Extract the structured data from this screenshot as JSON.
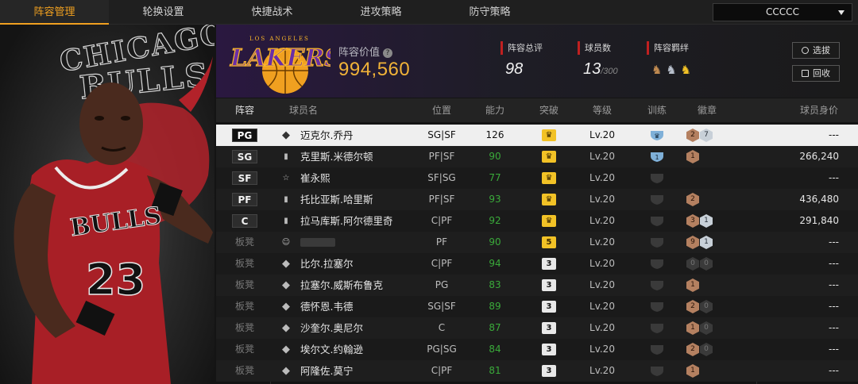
{
  "tabs": [
    "阵容管理",
    "轮换设置",
    "快捷战术",
    "进攻策略",
    "防守策略"
  ],
  "active_tab": 0,
  "team_select": {
    "value": "CCCCC"
  },
  "art": {
    "line1": "CHICAGO",
    "line2": "BULLS",
    "jersey_team": "BULLS",
    "jersey_number": "23"
  },
  "logo": {
    "small": "LOS ANGELES",
    "main": "LAKERS"
  },
  "header": {
    "value_label": "阵容价值",
    "help": "?",
    "value": "994,560",
    "overall_label": "阵容总评",
    "overall": "98",
    "players_label": "球员数",
    "players": "13",
    "players_max": "/300",
    "bond_label": "阵容羁绊",
    "btn_pick": "选拔",
    "btn_recycle": "回收"
  },
  "columns": [
    "阵容",
    "球员名",
    "位置",
    "能力",
    "突破",
    "等级",
    "训练",
    "徽章",
    "球员身价"
  ],
  "rows": [
    {
      "slot": "PG",
      "bench": false,
      "type": "COPY",
      "name": "迈克尔.乔丹",
      "pos": "SG|SF",
      "ability": "126",
      "breakthrough": "crown",
      "level": "Lv.20",
      "training": "blue",
      "badges": [
        [
          "b",
          "2"
        ],
        [
          "s",
          "7"
        ]
      ],
      "value": "---",
      "selected": true
    },
    {
      "slot": "SG",
      "bench": false,
      "type": "bars",
      "name": "克里斯.米德尔顿",
      "pos": "PF|SF",
      "ability": "90",
      "breakthrough": "crown",
      "level": "Lv.20",
      "training": "blue1",
      "badges": [
        [
          "b",
          "1"
        ]
      ],
      "value": "266,240"
    },
    {
      "slot": "SF",
      "bench": false,
      "type": "star",
      "name": "崔永熙",
      "pos": "SF|SG",
      "ability": "77",
      "breakthrough": "crown",
      "level": "Lv.20",
      "training": "none",
      "badges": [],
      "value": "---"
    },
    {
      "slot": "PF",
      "bench": false,
      "type": "bars",
      "name": "托比亚斯.哈里斯",
      "pos": "PF|SF",
      "ability": "93",
      "breakthrough": "crown",
      "level": "Lv.20",
      "training": "none",
      "badges": [
        [
          "b",
          "2"
        ]
      ],
      "value": "436,480"
    },
    {
      "slot": "C",
      "bench": false,
      "type": "bars",
      "name": "拉马库斯.阿尔德里奇",
      "pos": "C|PF",
      "ability": "92",
      "breakthrough": "crown",
      "level": "Lv.20",
      "training": "none",
      "badges": [
        [
          "b",
          "3"
        ],
        [
          "s",
          "1"
        ]
      ],
      "value": "291,840"
    },
    {
      "slot": "板凳",
      "bench": true,
      "type": "person",
      "name": "",
      "pos": "PF",
      "ability": "90",
      "breakthrough": "5",
      "level": "Lv.20",
      "training": "none",
      "badges": [
        [
          "b",
          "9"
        ],
        [
          "s",
          "1"
        ]
      ],
      "value": "---"
    },
    {
      "slot": "板凳",
      "bench": true,
      "type": "COPY",
      "name": "比尔.拉塞尔",
      "pos": "C|PF",
      "ability": "94",
      "breakthrough": "3",
      "level": "Lv.20",
      "training": "none",
      "badges": [
        [
          "d",
          "0"
        ],
        [
          "d",
          "0"
        ]
      ],
      "value": "---"
    },
    {
      "slot": "板凳",
      "bench": true,
      "type": "COPY",
      "name": "拉塞尔.威斯布鲁克",
      "pos": "PG",
      "ability": "83",
      "breakthrough": "3",
      "level": "Lv.20",
      "training": "none",
      "badges": [
        [
          "b",
          "1"
        ]
      ],
      "value": "---"
    },
    {
      "slot": "板凳",
      "bench": true,
      "type": "COPY",
      "name": "德怀恩.韦德",
      "pos": "SG|SF",
      "ability": "89",
      "breakthrough": "3",
      "level": "Lv.20",
      "training": "none",
      "badges": [
        [
          "b",
          "2"
        ],
        [
          "d",
          "0"
        ]
      ],
      "value": "---"
    },
    {
      "slot": "板凳",
      "bench": true,
      "type": "COPY",
      "name": "沙奎尔.奥尼尔",
      "pos": "C",
      "ability": "87",
      "breakthrough": "3",
      "level": "Lv.20",
      "training": "none",
      "badges": [
        [
          "b",
          "1"
        ],
        [
          "d",
          "0"
        ]
      ],
      "value": "---"
    },
    {
      "slot": "板凳",
      "bench": true,
      "type": "COPY",
      "name": "埃尔文.约翰逊",
      "pos": "PG|SG",
      "ability": "84",
      "breakthrough": "3",
      "level": "Lv.20",
      "training": "none",
      "badges": [
        [
          "b",
          "2"
        ],
        [
          "d",
          "0"
        ]
      ],
      "value": "---"
    },
    {
      "slot": "板凳",
      "bench": true,
      "type": "COPY",
      "name": "阿隆佐.莫宁",
      "pos": "C|PF",
      "ability": "81",
      "breakthrough": "3",
      "level": "Lv.20",
      "training": "none",
      "badges": [
        [
          "b",
          "1"
        ]
      ],
      "value": "---"
    }
  ],
  "colors": {
    "accent": "#f0a020",
    "value": "#f1b338",
    "ability": "#3aaa3a",
    "lakers_purple": "#552583",
    "lakers_gold": "#fdb927"
  }
}
